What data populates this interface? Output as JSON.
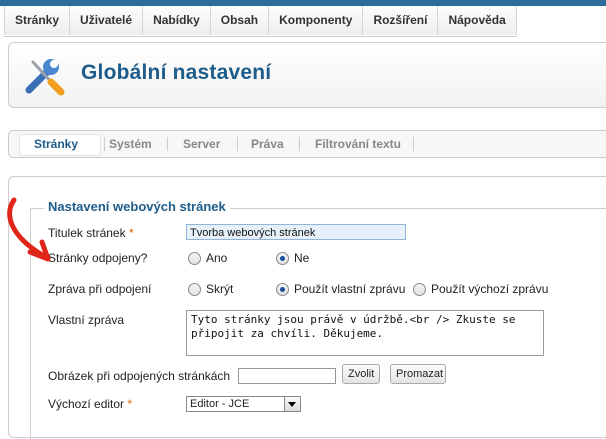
{
  "menu": {
    "items": [
      "Stránky",
      "Uživatelé",
      "Nabídky",
      "Obsah",
      "Komponenty",
      "Rozšíření",
      "Nápověda"
    ]
  },
  "header": {
    "title": "Globální nastavení",
    "icon": "tools-icon"
  },
  "tabs": {
    "items": [
      "Stránky",
      "Systém",
      "Server",
      "Práva",
      "Filtrování textu"
    ],
    "active": "Stránky"
  },
  "form": {
    "legend": "Nastavení webových stránek",
    "site_name": {
      "label": "Titulek stránek",
      "required_mark": "*",
      "value": "Tvorba webových stránek"
    },
    "offline": {
      "label": "Stránky odpojeny?",
      "options": [
        "Ano",
        "Ne"
      ],
      "selected": "Ne"
    },
    "offline_message": {
      "label": "Zpráva při odpojení",
      "options": [
        "Skrýt",
        "Použít vlastní zprávu",
        "Použít výchozí zprávu"
      ],
      "selected": "Použít vlastní zprávu"
    },
    "custom_message": {
      "label": "Vlastní zpráva",
      "value": "Tyto stránky jsou právě v údržbě.<br /> Zkuste se připojit za chvíli. Děkujeme."
    },
    "offline_image": {
      "label": "Obrázek při odpojených stránkách",
      "value": "",
      "select_label": "Zvolit",
      "clear_label": "Promazat"
    },
    "default_editor": {
      "label": "Výchozí editor",
      "required_mark": "*",
      "value": "Editor - JCE"
    }
  },
  "colors": {
    "accent": "#1e5c8a",
    "annotation_arrow": "#e0261b",
    "required": "#e06000"
  }
}
